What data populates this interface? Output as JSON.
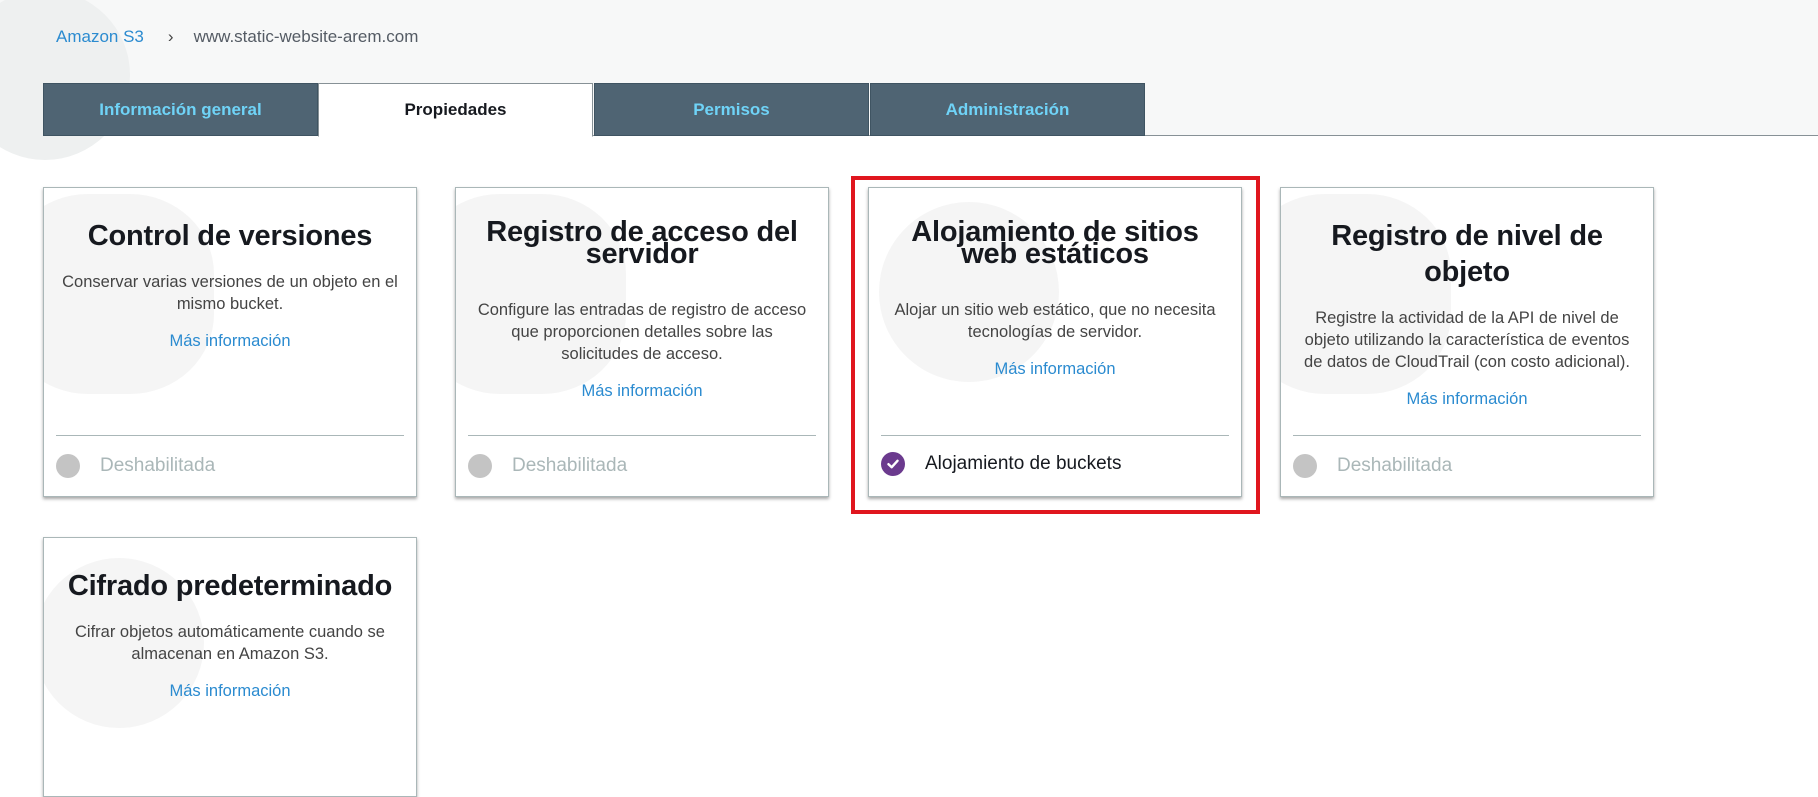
{
  "breadcrumb": {
    "root": "Amazon S3",
    "separator": "›",
    "current": "www.static-website-arem.com"
  },
  "tabs": [
    {
      "label": "Información general",
      "active": false
    },
    {
      "label": "Propiedades",
      "active": true
    },
    {
      "label": "Permisos",
      "active": false
    },
    {
      "label": "Administración",
      "active": false
    }
  ],
  "cards": [
    {
      "title": "Control de versiones",
      "description": "Conservar varias versiones de un objeto en el mismo bucket.",
      "link": "Más información",
      "status": "Deshabilitada",
      "enabled": false
    },
    {
      "title": "Registro de acceso del servidor",
      "description": "Configure las entradas de registro de acceso que proporcionen detalles sobre las solicitudes de acceso.",
      "link": "Más información",
      "status": "Deshabilitada",
      "enabled": false
    },
    {
      "title": "Alojamiento de sitios web estáticos",
      "description": "Alojar un sitio web estático, que no necesita tecnologías de servidor.",
      "link": "Más información",
      "status": "Alojamiento de buckets",
      "enabled": true
    },
    {
      "title": "Registro de nivel de objeto",
      "description": "Registre la actividad de la API de nivel de objeto utilizando la característica de eventos de datos de CloudTrail (con costo adicional).",
      "link": "Más información",
      "status": "Deshabilitada",
      "enabled": false
    },
    {
      "title": "Cifrado predeterminado",
      "description": "Cifrar objetos automáticamente cuando se almacenan en Amazon S3.",
      "link": "Más información"
    }
  ],
  "colors": {
    "accent_link": "#2b8bd0",
    "tab_bg": "#4f6473",
    "tab_text": "#6fd3f7",
    "enabled_check": "#6b3a8e",
    "highlight_border": "#e0161e"
  }
}
